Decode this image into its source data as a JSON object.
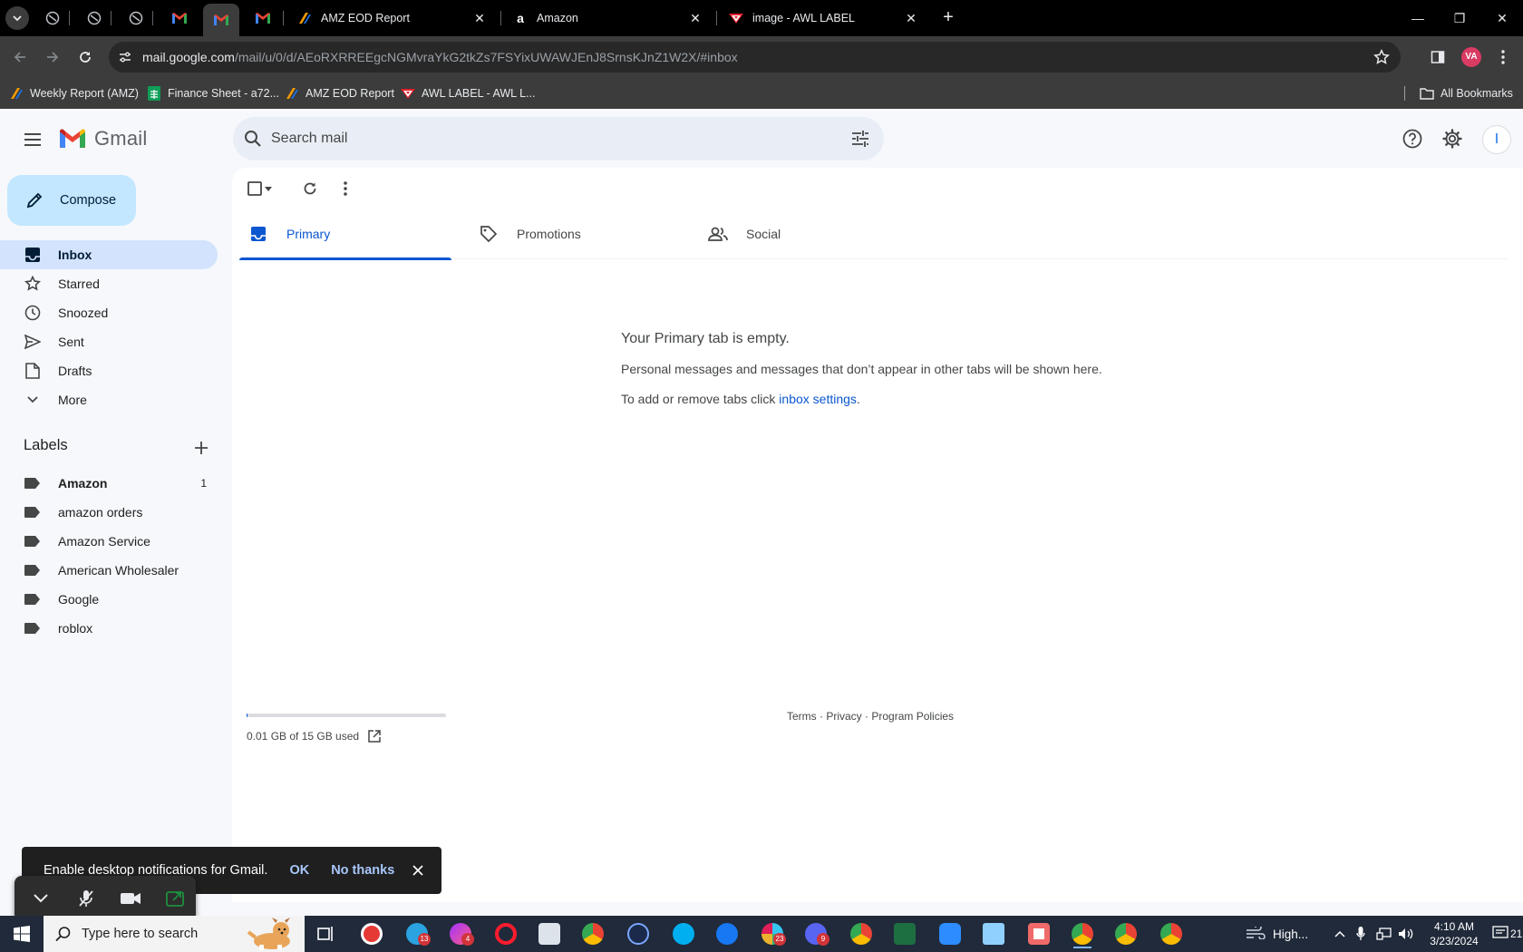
{
  "browser": {
    "tabs": [
      {
        "title": "AMZ EOD Report",
        "icon": "amz-eod-favicon-icon"
      },
      {
        "title": "Amazon",
        "icon": "amazon-favicon-icon"
      },
      {
        "title": "image - AWL LABEL",
        "icon": "awl-label-favicon-icon"
      }
    ],
    "url_host": "mail.google.com",
    "url_path": "/mail/u/0/d/AEoRXRREEgcNGMvraYkG2tkZs7FSYixUWAWJEnJ8SrnsKJnZ1W2X/#inbox",
    "profile_initials": "VA",
    "bookmarks": [
      {
        "label": "Weekly Report (AMZ)",
        "icon": "amz-report-icon"
      },
      {
        "label": "Finance Sheet - a72...",
        "icon": "sheets-icon"
      },
      {
        "label": "AMZ EOD Report",
        "icon": "amz-eod-icon"
      },
      {
        "label": "AWL LABEL - AWL L...",
        "icon": "awl-label-icon"
      }
    ],
    "all_bookmarks_label": "All Bookmarks"
  },
  "gmail": {
    "wordmark": "Gmail",
    "search_placeholder": "Search mail",
    "avatar_initial": "I",
    "compose_label": "Compose",
    "nav": [
      {
        "label": "Inbox",
        "icon": "inbox-icon",
        "active": true
      },
      {
        "label": "Starred",
        "icon": "star-icon"
      },
      {
        "label": "Snoozed",
        "icon": "clock-icon"
      },
      {
        "label": "Sent",
        "icon": "send-icon"
      },
      {
        "label": "Drafts",
        "icon": "draft-icon"
      },
      {
        "label": "More",
        "icon": "chevron-down-icon"
      }
    ],
    "labels_heading": "Labels",
    "labels": [
      {
        "label": "Amazon",
        "count": "1",
        "bold": true
      },
      {
        "label": "amazon orders"
      },
      {
        "label": "Amazon Service"
      },
      {
        "label": "American Wholesaler"
      },
      {
        "label": "Google"
      },
      {
        "label": "roblox"
      }
    ],
    "category_tabs": [
      {
        "label": "Primary",
        "icon": "inbox-tab-icon",
        "active": true
      },
      {
        "label": "Promotions",
        "icon": "tag-icon"
      },
      {
        "label": "Social",
        "icon": "people-icon"
      }
    ],
    "empty_title": "Your Primary tab is empty.",
    "empty_body": "Personal messages and messages that don’t appear in other tabs will be shown here.",
    "empty_settings_prefix": "To add or remove tabs click ",
    "empty_settings_link": "inbox settings",
    "empty_settings_suffix": ".",
    "storage_text": "0.01 GB of 15 GB used",
    "footer": {
      "terms": "Terms",
      "privacy": "Privacy",
      "policies": "Program Policies",
      "sep": " · "
    },
    "notification": {
      "message": "Enable desktop notifications for Gmail.",
      "ok": "OK",
      "no_thanks": "No thanks"
    }
  },
  "taskbar": {
    "search_placeholder": "Type here to search",
    "weather": "High...",
    "time": "4:10 AM",
    "date": "3/23/2024",
    "notification_count": "21",
    "badges": {
      "telegram": "13",
      "messenger": "4",
      "slack": "23",
      "discord": "9"
    }
  },
  "colors": {
    "accent": "#0b57d0",
    "compose_bg": "#c2e7ff",
    "active_nav_bg": "#d3e3fd",
    "page_bg": "#f6f8fc"
  }
}
